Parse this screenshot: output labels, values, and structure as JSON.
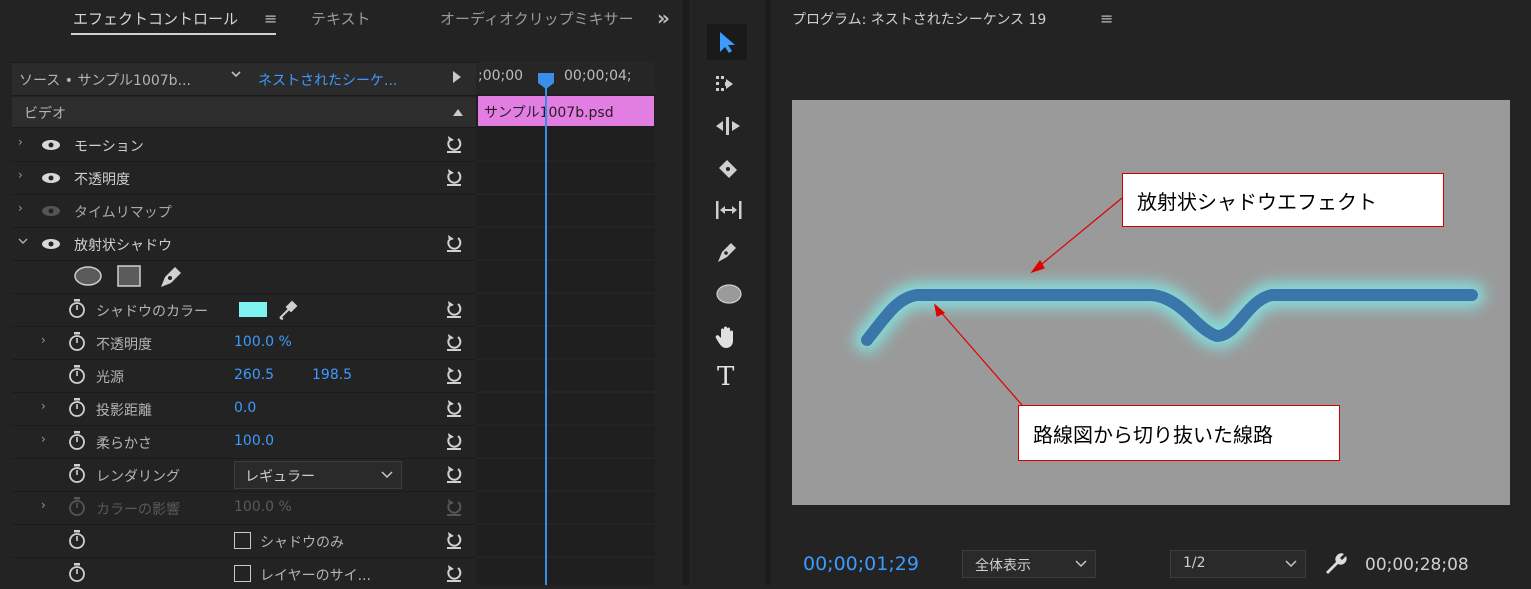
{
  "left_panel": {
    "tabs": [
      {
        "label": "エフェクトコントロール",
        "active": true
      },
      {
        "label": "テキスト",
        "active": false
      },
      {
        "label": "オーディオクリップミキサー",
        "active": false
      }
    ],
    "menu_icon": "≡",
    "overflow_icon": "»",
    "source_label": "ソース • サンプル1007b...",
    "sequence_label": "ネストされたシーケ...",
    "timecode_start": ";00;00",
    "timecode_end": "00;00;04;",
    "video_header": "ビデオ",
    "clip_label": "サンプル1007b.psd",
    "effects": {
      "motion": "モーション",
      "opacity": "不透明度",
      "time_remap": "タイムリマップ",
      "radial_shadow": "放射状シャドウ"
    },
    "properties": {
      "shadow_color_label": "シャドウのカラー",
      "shadow_color": "#7ff3f0",
      "opacity_label": "不透明度",
      "opacity_value": "100.0 %",
      "light_source_label": "光源",
      "light_x": "260.5",
      "light_y": "198.5",
      "projection_label": "投影距離",
      "projection_value": "0.0",
      "softness_label": "柔らかさ",
      "softness_value": "100.0",
      "rendering_label": "レンダリング",
      "rendering_value": "レギュラー",
      "color_influence_label": "カラーの影響",
      "color_influence_value": "100.0 %",
      "shadow_only_label": "シャドウのみ",
      "resize_layer_label": "レイヤーのサイ..."
    }
  },
  "toolbar": {
    "tools": [
      "selection-tool",
      "track-select-tool",
      "ripple-edit-tool",
      "razor-tool",
      "slip-tool",
      "pen-tool",
      "ellipse-tool",
      "hand-tool",
      "type-tool"
    ],
    "type_glyph": "T"
  },
  "program": {
    "title": "プログラム: ネストされたシーケンス 19",
    "menu_icon": "≡",
    "callout_top": "放射状シャドウエフェクト",
    "callout_bottom": "路線図から切り抜いた線路",
    "current_time": "00;00;01;29",
    "zoom": "全体表示",
    "resolution": "1/2",
    "duration": "00;00;28;08",
    "stroke_color": "#3a76aa",
    "glow_color": "#7ff3f0",
    "accent_color": "#3d9bff"
  }
}
